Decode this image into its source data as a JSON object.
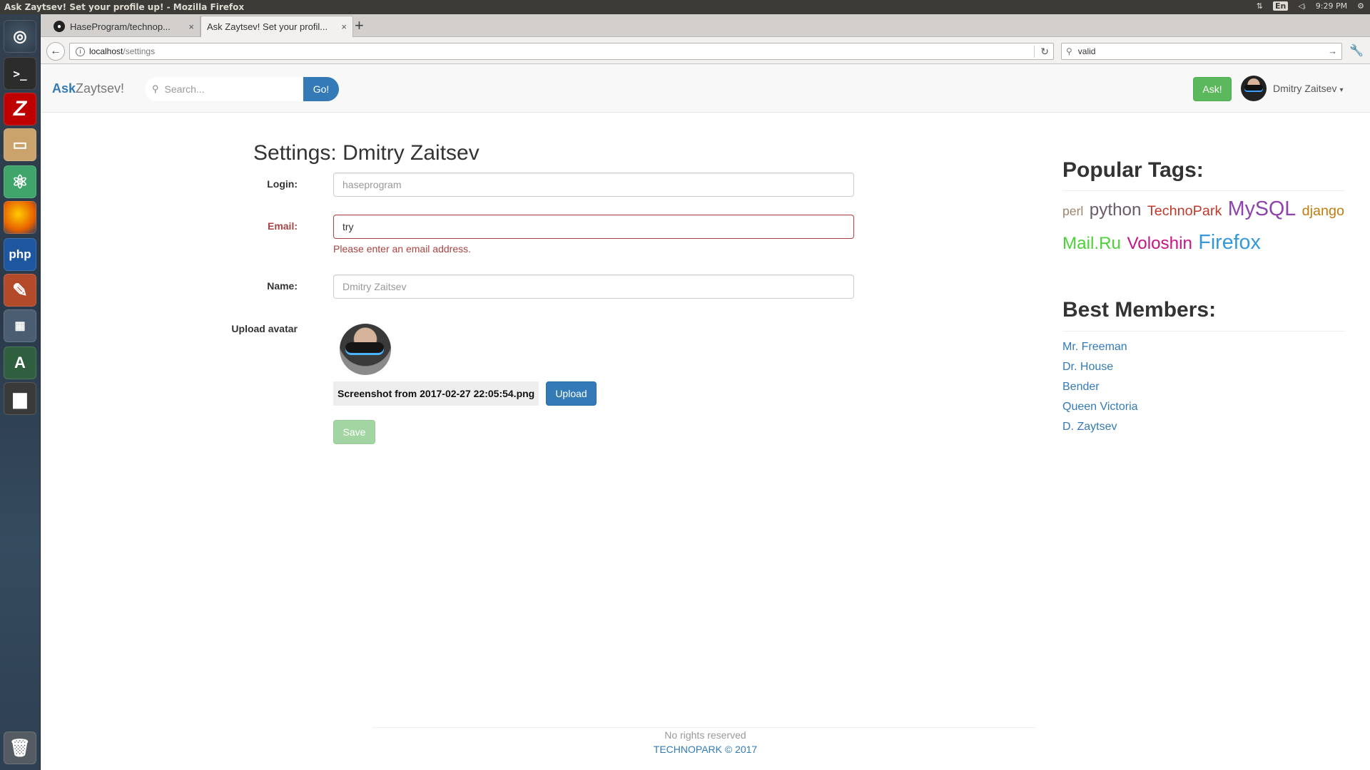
{
  "os": {
    "window_title": "Ask Zaytsev! Set your profile up! - Mozilla Firefox",
    "lang": "En",
    "time": "9:29 PM",
    "network_icon": "⇅",
    "volume_icon": "◁ᵢ",
    "settings_icon": "⚙"
  },
  "launcher": {
    "items": [
      "ubuntu-dash",
      "terminal",
      "filezilla",
      "files",
      "atom",
      "firefox",
      "phpstorm",
      "system-tools",
      "workspaces",
      "software-updater",
      "disk",
      "trash"
    ],
    "glyphs": {
      "ubuntu": "◎",
      "terminal": ">_",
      "filezilla": "Z",
      "files": "▭",
      "atom": "⚛",
      "firefox": "",
      "php": "php",
      "tools": "✎",
      "workspaces": "▦",
      "updater": "A",
      "save": "▆",
      "trash": "🗑"
    }
  },
  "browser": {
    "tabs": [
      {
        "label": "HaseProgram/technop...",
        "icon": "github-icon",
        "close": "×"
      },
      {
        "label": "Ask Zaytsev! Set your profil...",
        "close": "×"
      }
    ],
    "new_tab": "+",
    "back": "←",
    "url_host": "localhost",
    "url_path": "/settings",
    "info": "i",
    "reload": "↻",
    "search_value": "valid",
    "search_go": "→",
    "wrench": "🔧",
    "menu": "☰"
  },
  "site": {
    "brand_ask": "Ask",
    "brand_rest": "Zaytsev!",
    "search_placeholder": "Search...",
    "go_label": "Go!",
    "ask_label": "Ask!",
    "user_name": "Dmitry Zaitsev",
    "caret": "▾"
  },
  "settings": {
    "title": "Settings: Dmitry Zaitsev",
    "login_label": "Login:",
    "login_value": "haseprogram",
    "email_label": "Email:",
    "email_value": "try",
    "email_error": "Please enter an email address.",
    "name_label": "Name:",
    "name_value": "Dmitry Zaitsev",
    "upload_label": "Upload avatar",
    "file_name": "Screenshot from 2017-02-27 22:05:54.png",
    "upload_button": "Upload",
    "save_button": "Save"
  },
  "sidebar": {
    "tags_heading": "Popular Tags:",
    "tags": [
      {
        "text": "perl",
        "color": "#a0826d",
        "size": 16
      },
      {
        "text": "python",
        "color": "#6b5b6b",
        "size": 22
      },
      {
        "text": "TechnoPark",
        "color": "#c0392b",
        "size": 18
      },
      {
        "text": "MySQL",
        "color": "#8e44ad",
        "size": 26
      },
      {
        "text": "django",
        "color": "#c27c0e",
        "size": 18
      },
      {
        "text": "Mail.Ru",
        "color": "#4cd137",
        "size": 22
      },
      {
        "text": "Voloshin",
        "color": "#c71585",
        "size": 22
      },
      {
        "text": "Firefox",
        "color": "#3498db",
        "size": 26
      }
    ],
    "members_heading": "Best Members:",
    "members": [
      "Mr. Freeman",
      "Dr. House",
      "Bender",
      "Queen Victoria",
      "D. Zaytsev"
    ]
  },
  "footer": {
    "rights": "No rights reserved",
    "copyright": "TECHNOPARK ©  2017"
  }
}
